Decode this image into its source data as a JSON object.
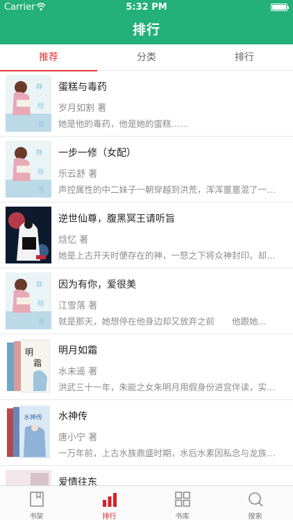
{
  "status": {
    "carrier": "Carrier",
    "time": "5:32 PM"
  },
  "header": {
    "title": "排行"
  },
  "tabs": [
    {
      "label": "推荐",
      "active": true
    },
    {
      "label": "分类",
      "active": false
    },
    {
      "label": "排行",
      "active": false
    }
  ],
  "books": [
    {
      "title": "蛋糕与毒药",
      "author": "岁月如割 著",
      "desc": "她是他的毒药，他是她的蛋糕……"
    },
    {
      "title": "一步一修（女配）",
      "author": "乐云舒 著",
      "desc": "声控属性的中二妹子一朝穿越到洪荒，浑浑噩噩混了一…"
    },
    {
      "title": "逆世仙尊，腹黑冥王请听旨",
      "author": "焓忆 著",
      "desc": "她是上古开天时便存在的神，一怒之下将众神封印。却…"
    },
    {
      "title": "因为有你，爱很美",
      "author": "江雪落 著",
      "desc": "就是那天，她想停在他身边却又放弃之前　　他跟她…"
    },
    {
      "title": "明月如霜",
      "author": "水未遥 著",
      "desc": "洪武三十一年，朱能之女朱明月用假身份进宫伴读，实…"
    },
    {
      "title": "水神传",
      "author": "唐小宁 著",
      "desc": "一万年前，上古水族鼎盛时期，水后水素因私念与龙族…"
    },
    {
      "title": "爱情往东",
      "author": "",
      "desc": ""
    }
  ],
  "tabbar": [
    {
      "label": "书架",
      "icon": "book-icon",
      "active": false
    },
    {
      "label": "排行",
      "icon": "bar-chart-icon",
      "active": true
    },
    {
      "label": "书库",
      "icon": "grid-icon",
      "active": false
    },
    {
      "label": "搜索",
      "icon": "search-icon",
      "active": false
    }
  ],
  "colors": {
    "header": "#23b07a",
    "accent": "#e03232",
    "tab_active": "#d8202a"
  }
}
